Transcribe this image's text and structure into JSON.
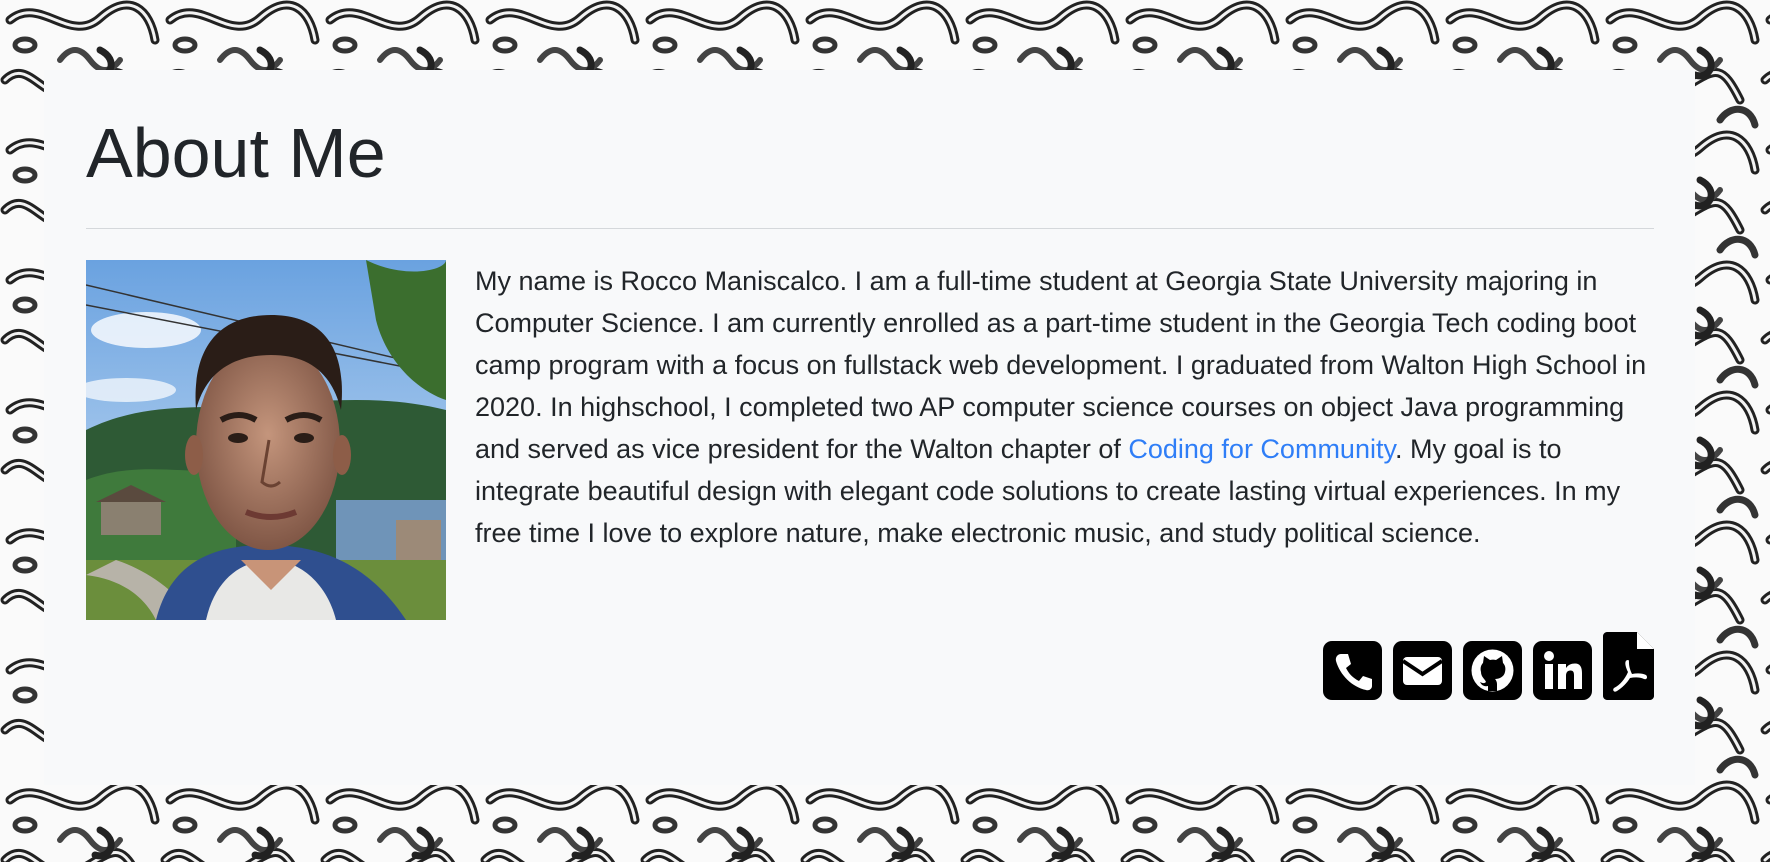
{
  "page": {
    "title": "About Me"
  },
  "bio": {
    "before_link": "My name is Rocco Maniscalco. I am a full-time student at Georgia State University majoring in Computer Science. I am currently enrolled as a part-time student in the Georgia Tech coding boot camp program with a focus on fullstack web development. I graduated from Walton High School in 2020. In highschool, I completed two AP computer science courses on object Java programming and served as vice president for the Walton chapter of ",
    "link_text": "Coding for Community",
    "after_link": ". My goal is to integrate beautiful design with elegant code solutions to create lasting virtual experiences. In my free time I love to explore nature, make electronic music, and study political science."
  },
  "contact_icons": [
    {
      "name": "phone-icon"
    },
    {
      "name": "envelope-icon"
    },
    {
      "name": "github-icon"
    },
    {
      "name": "linkedin-icon"
    },
    {
      "name": "pdf-file-icon"
    }
  ],
  "colors": {
    "card_background": "#f8f9fa",
    "text": "#212529",
    "link": "#2f7ef7",
    "icon": "#000000"
  }
}
